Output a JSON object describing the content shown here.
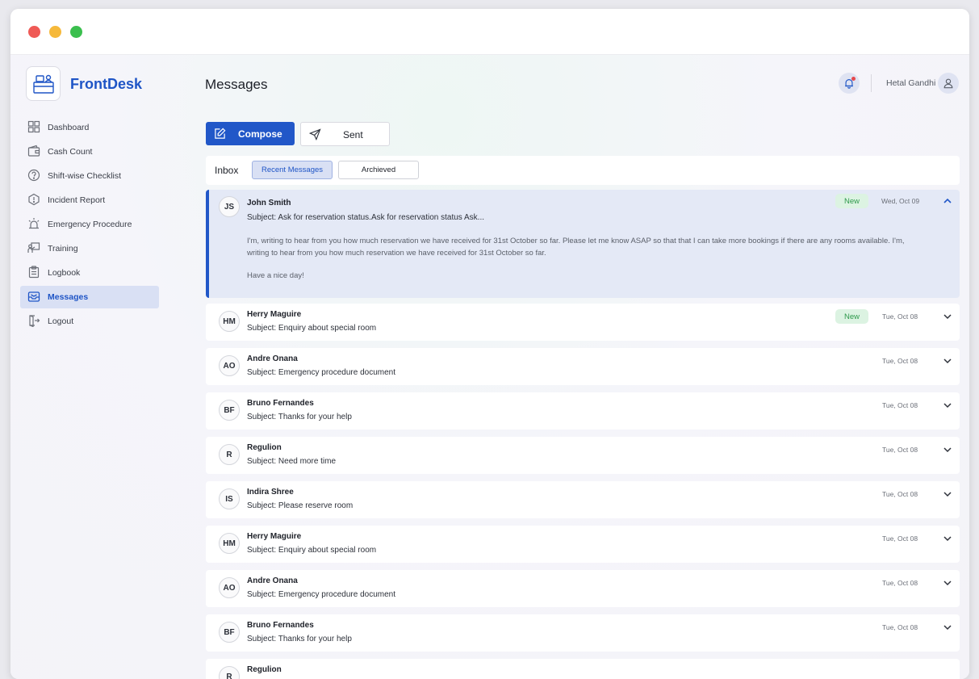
{
  "app": {
    "brand": "FrontDesk",
    "page_title": "Messages",
    "user_name": "Hetal Gandhi",
    "accent": "#2157c8"
  },
  "sidebar": {
    "items": [
      {
        "label": "Dashboard",
        "icon": "dashboard-icon"
      },
      {
        "label": "Cash Count",
        "icon": "wallet-icon"
      },
      {
        "label": "Shift-wise Checklist",
        "icon": "question-circle-icon"
      },
      {
        "label": "Incident Report",
        "icon": "incident-icon"
      },
      {
        "label": "Emergency Procedure",
        "icon": "siren-icon"
      },
      {
        "label": "Training",
        "icon": "training-icon"
      },
      {
        "label": "Logbook",
        "icon": "clipboard-icon"
      },
      {
        "label": "Messages",
        "icon": "inbox-icon",
        "active": true
      },
      {
        "label": "Logout",
        "icon": "logout-icon"
      }
    ]
  },
  "actions": {
    "compose_label": "Compose",
    "sent_label": "Sent"
  },
  "tabs": {
    "inbox_label": "Inbox",
    "recent_label": "Recent Messages",
    "archived_label": "Archieved"
  },
  "messages": [
    {
      "initials": "JS",
      "sender": "John Smith",
      "subject": "Subject: Ask for reservation status.Ask for reservation status Ask...",
      "badge": "New",
      "date": "Wed, Oct 09",
      "expanded": true,
      "body": "I'm, writing to hear from you how much reservation we have received for 31st October so far. Please let me know ASAP so that that I can take more bookings if there are any rooms available. I'm, writing to hear from you how much reservation we have received for 31st October so far.",
      "signoff": "Have a nice day!"
    },
    {
      "initials": "HM",
      "sender": "Herry Maguire",
      "subject": "Subject: Enquiry about special room",
      "badge": "New",
      "date": "Tue, Oct 08"
    },
    {
      "initials": "AO",
      "sender": "Andre Onana",
      "subject": "Subject: Emergency procedure document",
      "date": "Tue, Oct 08"
    },
    {
      "initials": "BF",
      "sender": "Bruno Fernandes",
      "subject": "Subject: Thanks for your help",
      "date": "Tue, Oct 08"
    },
    {
      "initials": "R",
      "sender": "Regulion",
      "subject": "Subject: Need more time",
      "date": "Tue, Oct 08"
    },
    {
      "initials": "IS",
      "sender": "Indira Shree",
      "subject": "Subject: Please reserve room",
      "date": "Tue, Oct 08"
    },
    {
      "initials": "HM",
      "sender": "Herry Maguire",
      "subject": "Subject: Enquiry about special room",
      "date": "Tue, Oct 08"
    },
    {
      "initials": "AO",
      "sender": "Andre Onana",
      "subject": "Subject: Emergency procedure document",
      "date": "Tue, Oct 08"
    },
    {
      "initials": "BF",
      "sender": "Bruno Fernandes",
      "subject": "Subject: Thanks for your help",
      "date": "Tue, Oct 08"
    },
    {
      "initials": "R",
      "sender": "Regulion",
      "subject": "",
      "date": ""
    }
  ]
}
